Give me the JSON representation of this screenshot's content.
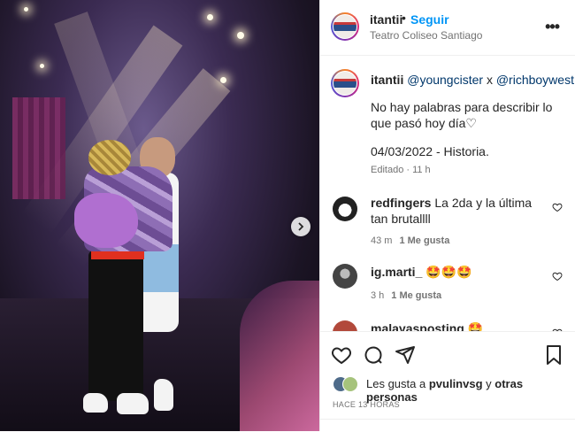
{
  "header": {
    "username": "itantii",
    "separator": "•",
    "follow_label": "Seguir",
    "location": "Teatro Coliseo Santiago",
    "more_icon": "more-horizontal-icon"
  },
  "caption": {
    "username": "itantii",
    "mention_1": "@youngcister",
    "joiner": "x",
    "mention_2": "@richboywest",
    "line_1": "No hay palabras para describir lo que pasó hoy día♡",
    "line_2": "04/03/2022 - Historia.",
    "edited": "Editado · 11 h"
  },
  "comments": [
    {
      "username": "redfingers",
      "text": "La 2da y la última tan brutallll",
      "time": "43 m",
      "likes": "1 Me gusta"
    },
    {
      "username": "ig.marti_",
      "text": "🤩🤩🤩",
      "time": "3 h",
      "likes": "1 Me gusta"
    },
    {
      "username": "malayasposting",
      "text": "🤩",
      "time": "",
      "likes": ""
    }
  ],
  "likes": {
    "prefix": "Les gusta a",
    "user": "pvulinvsg",
    "joiner": "y",
    "others": "otras personas"
  },
  "timestamp": "HACE 13 HORAS",
  "colors": {
    "follow": "#0095f6",
    "mention": "#00376b",
    "secondary_text": "#737373"
  }
}
